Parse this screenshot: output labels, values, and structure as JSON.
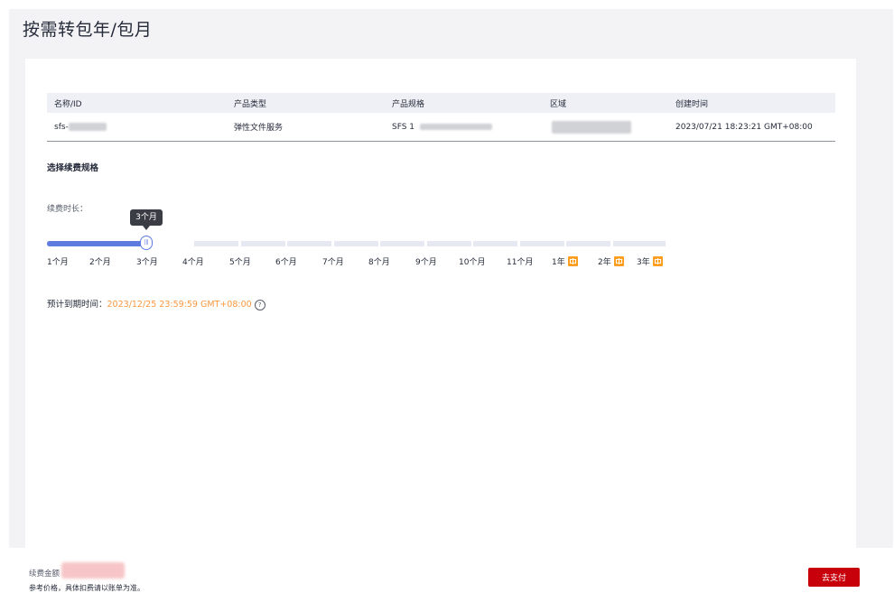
{
  "page": {
    "title": "按需转包年/包月"
  },
  "table": {
    "headers": [
      "名称/ID",
      "产品类型",
      "产品规格",
      "区域",
      "创建时间"
    ],
    "row": {
      "name": "sfs-",
      "type": "弹性文件服务",
      "spec": "SFS 1",
      "region": "",
      "created": "2023/07/21 18:23:21 GMT+08:00"
    }
  },
  "renewal": {
    "section_title": "选择续费规格",
    "duration_label": "续费时长：",
    "tooltip": "3个月",
    "selected_value": 3,
    "selected_fraction": 0.1667,
    "months": [
      "1个月",
      "2个月",
      "3个月",
      "4个月",
      "5个月",
      "6个月",
      "7个月",
      "8个月",
      "9个月",
      "10个月",
      "11个月"
    ],
    "years": [
      "1年",
      "2年",
      "3年"
    ],
    "gift_icon": "gift-icon",
    "expiry_label": "预计到期时间：",
    "expiry_value": "2023/12/25 23:59:59 GMT+08:00",
    "help_icon": "help-circle-icon"
  },
  "footer": {
    "fee_label": "续费金额",
    "note": "参考价格，具体扣费请以账单为准。",
    "pay_button": "去支付"
  },
  "colors": {
    "slider_fill": "#5e7ce0",
    "expiry_value": "#fa9841",
    "gift_badge": "#ff9e1f",
    "pay_button": "#c7000b"
  }
}
